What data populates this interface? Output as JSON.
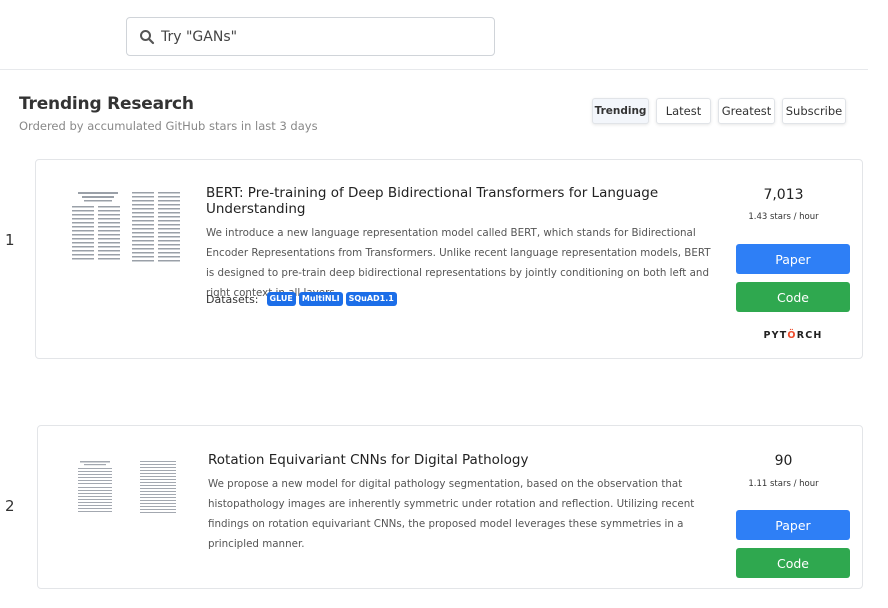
{
  "search": {
    "placeholder": "Try \"GANs\""
  },
  "section": {
    "title": "Trending Research",
    "subtitle": "Ordered by accumulated GitHub stars in last 3 days"
  },
  "tabs": [
    {
      "label": "Trending",
      "active": true
    },
    {
      "label": "Latest",
      "active": false
    },
    {
      "label": "Greatest",
      "active": false
    },
    {
      "label": "Subscribe",
      "active": false
    }
  ],
  "papers": [
    {
      "rank": "1",
      "title": "BERT: Pre-training of Deep Bidirectional Transformers for Language Understanding",
      "abstract": "We introduce a new language representation model called BERT, which stands for Bidirectional Encoder Representations from Transformers. Unlike recent language representation models, BERT is designed to pre-train deep bidirectional representations by jointly conditioning on both left and right context in all layers.",
      "datasets_label": "Datasets:",
      "datasets": [
        "GLUE",
        "MultiNLI",
        "SQuAD1.1"
      ],
      "stars": "7,013",
      "rate": "1.43 stars / hour",
      "paper_label": "Paper",
      "code_label": "Code",
      "framework": {
        "pre": "PYT",
        "flame": "Ö",
        "post": "RCH"
      }
    },
    {
      "rank": "2",
      "title": "Rotation Equivariant CNNs for Digital Pathology",
      "abstract": "We propose a new model for digital pathology segmentation, based on the observation that histopathology images are inherently symmetric under rotation and reflection. Utilizing recent findings on rotation equivariant CNNs, the proposed model leverages these symmetries in a principled manner.",
      "stars": "90",
      "rate": "1.11 stars / hour",
      "paper_label": "Paper",
      "code_label": "Code"
    }
  ],
  "colors": {
    "paper_button": "#2e7ff6",
    "code_button": "#2fa84f",
    "dataset_badge": "#1c6ee8",
    "pytorch_flame": "#ee4c2c"
  },
  "icons": {
    "search": "search-icon"
  }
}
